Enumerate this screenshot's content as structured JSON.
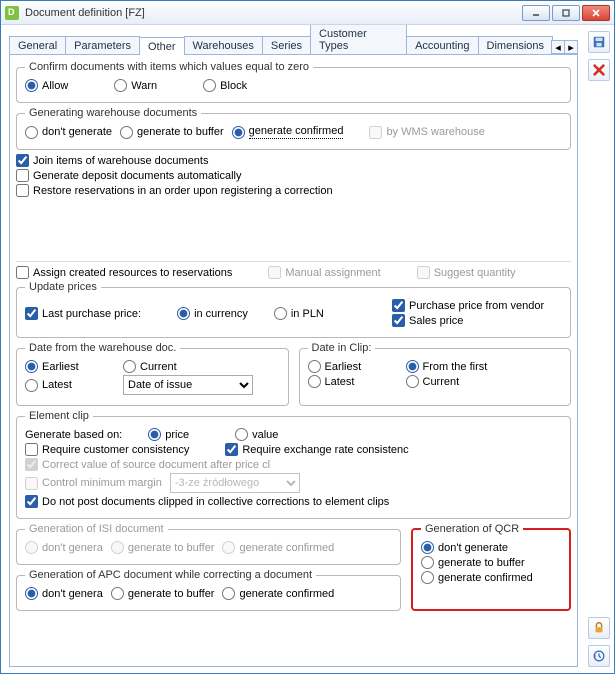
{
  "window": {
    "title": "Document definition [FZ]"
  },
  "tabs": [
    "General",
    "Parameters",
    "Other",
    "Warehouses",
    "Series",
    "Customer Types",
    "Accounting",
    "Dimensions"
  ],
  "tabs_selected": 2,
  "confirm_zero": {
    "legend": "Confirm documents with items which values equal to zero",
    "options": [
      "Allow",
      "Warn",
      "Block"
    ],
    "selected": 0
  },
  "gen_wh": {
    "legend": "Generating warehouse documents",
    "options": [
      "don't generate",
      "generate to buffer",
      "generate confirmed"
    ],
    "selected": 2,
    "by_wms": "by WMS warehouse"
  },
  "checks1": {
    "join": "Join items of warehouse documents",
    "deposit": "Generate deposit documents automatically",
    "restore": "Restore reservations in an order upon registering a correction"
  },
  "assign_res": {
    "main": "Assign created resources to reservations",
    "manual": "Manual assignment",
    "suggest": "Suggest quantity"
  },
  "update_prices": {
    "legend": "Update prices",
    "last": "Last purchase price:",
    "in_currency": "in currency",
    "in_pln": "in PLN",
    "vendor": "Purchase price from vendor",
    "sales": "Sales price"
  },
  "date_wh": {
    "legend": "Date from the warehouse doc.",
    "options": [
      "Earliest",
      "Current",
      "Latest"
    ],
    "selected": 0,
    "dropdown": "Date of issue"
  },
  "date_clip": {
    "legend": "Date in Clip:",
    "options": [
      "Earliest",
      "From the first",
      "Latest",
      "Current"
    ],
    "selected": 1
  },
  "element_clip": {
    "legend": "Element clip",
    "based_on": "Generate based on:",
    "price": "price",
    "value": "value",
    "req_customer": "Require customer consistency",
    "req_exch": "Require exchange rate consistenc",
    "correct_val": "Correct value of source document after price cl",
    "ctrl_margin": "Control minimum margin",
    "margin_val": "-3-ze źródłowego",
    "dont_post": "Do not post documents clipped in collective corrections to element clips"
  },
  "gen_isi": {
    "legend": "Generation of ISI document",
    "options": [
      "don't genera",
      "generate to buffer",
      "generate confirmed"
    ]
  },
  "gen_apc": {
    "legend": "Generation of APC document while correcting a document",
    "options": [
      "don't genera",
      "generate to buffer",
      "generate confirmed"
    ],
    "selected": 0
  },
  "gen_qcr": {
    "legend": "Generation of QCR",
    "options": [
      "don't generate",
      "generate to buffer",
      "generate confirmed"
    ],
    "selected": 0
  }
}
